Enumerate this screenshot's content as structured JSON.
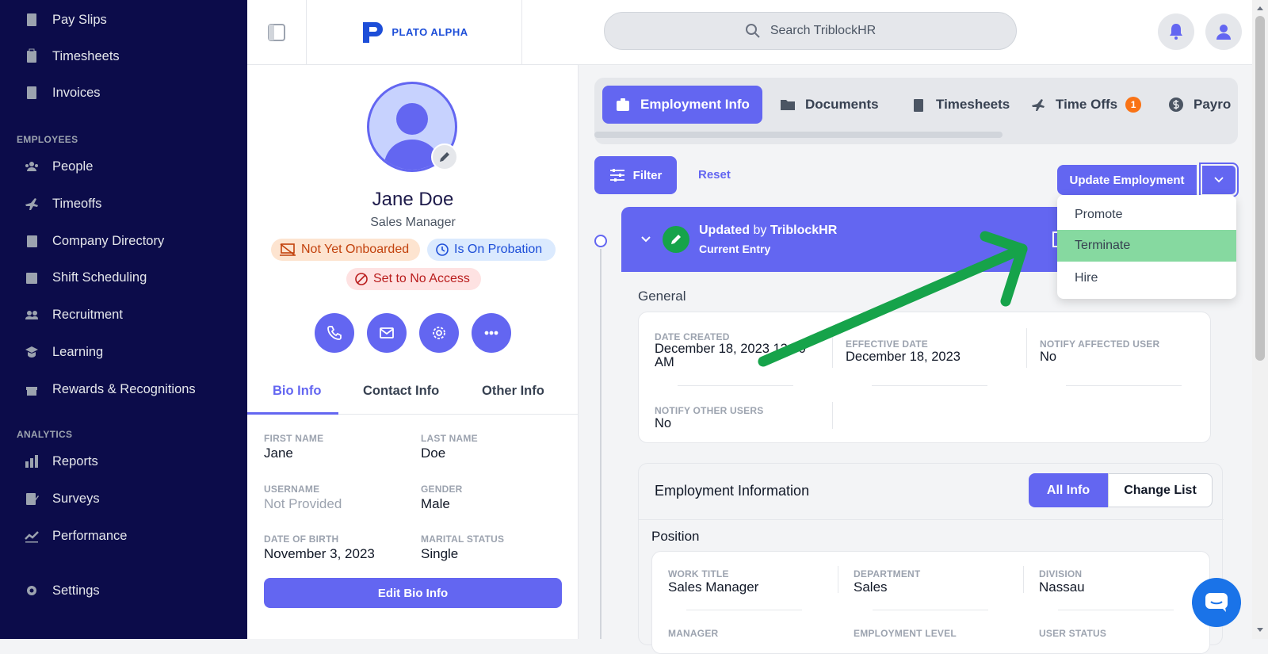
{
  "sidebar": {
    "items_top": [
      {
        "label": "Pay Slips",
        "icon": "payslip-icon"
      },
      {
        "label": "Timesheets",
        "icon": "clipboard-icon"
      },
      {
        "label": "Invoices",
        "icon": "calculator-icon"
      }
    ],
    "employees_section": "EMPLOYEES",
    "employees_items": [
      {
        "label": "People",
        "icon": "people-icon"
      },
      {
        "label": "Timeoffs",
        "icon": "plane-icon"
      },
      {
        "label": "Company Directory",
        "icon": "directory-icon"
      },
      {
        "label": "Shift Scheduling",
        "icon": "calendar-icon"
      },
      {
        "label": "Recruitment",
        "icon": "recruitment-icon"
      },
      {
        "label": "Learning",
        "icon": "learning-icon"
      },
      {
        "label": "Rewards & Recognitions",
        "icon": "gift-icon"
      }
    ],
    "analytics_section": "ANALYTICS",
    "analytics_items": [
      {
        "label": "Reports",
        "icon": "bar-chart-icon"
      },
      {
        "label": "Surveys",
        "icon": "survey-icon"
      },
      {
        "label": "Performance",
        "icon": "trend-icon"
      }
    ],
    "settings_label": "Settings"
  },
  "header": {
    "logo_text": "PLATO ALPHA",
    "search_placeholder": "Search TriblockHR"
  },
  "profile": {
    "name": "Jane Doe",
    "title": "Sales Manager",
    "badges": {
      "onboarded": "Not Yet Onboarded",
      "probation": "Is On Probation",
      "access": "Set to No Access"
    },
    "tabs": [
      "Bio Info",
      "Contact Info",
      "Other Info"
    ],
    "fields": {
      "first_name_label": "FIRST NAME",
      "first_name": "Jane",
      "last_name_label": "LAST NAME",
      "last_name": "Doe",
      "username_label": "USERNAME",
      "username": "Not Provided",
      "gender_label": "GENDER",
      "gender": "Male",
      "dob_label": "DATE OF BIRTH",
      "dob": "November 3, 2023",
      "marital_label": "MARITAL STATUS",
      "marital": "Single"
    },
    "edit_button": "Edit Bio Info"
  },
  "main": {
    "tabs": [
      {
        "label": "Employment Info",
        "active": true
      },
      {
        "label": "Documents"
      },
      {
        "label": "Timesheets"
      },
      {
        "label": "Time Offs",
        "badge": "1"
      },
      {
        "label": "Payro"
      }
    ],
    "filter_label": "Filter",
    "reset_label": "Reset",
    "update_button": "Update Employment",
    "dropdown_options": [
      "Promote",
      "Terminate",
      "Hire"
    ],
    "selected_option": "Terminate",
    "entry": {
      "updated": "Updated",
      "by": "by",
      "author": "TriblockHR",
      "subtitle": "Current Entry"
    },
    "general": {
      "heading": "General",
      "date_created_label": "DATE CREATED",
      "date_created": "December 18, 2023 12:00 AM",
      "effective_date_label": "EFFECTIVE DATE",
      "effective_date": "December 18, 2023",
      "notify_affected_label": "NOTIFY AFFECTED USER",
      "notify_affected": "No",
      "notify_other_label": "NOTIFY OTHER USERS",
      "notify_other": "No"
    },
    "employment": {
      "heading": "Employment Information",
      "all_info": "All Info",
      "change_list": "Change List",
      "position_heading": "Position",
      "work_title_label": "WORK TITLE",
      "work_title": "Sales Manager",
      "department_label": "DEPARTMENT",
      "department": "Sales",
      "division_label": "DIVISION",
      "division": "Nassau",
      "manager_label": "MANAGER",
      "level_label": "EMPLOYMENT LEVEL",
      "user_status_label": "USER STATUS"
    }
  },
  "colors": {
    "sidebar_bg": "#0c0c4a",
    "accent": "#6366f1",
    "arrow": "#16a34a",
    "highlight": "#86d9a0"
  }
}
